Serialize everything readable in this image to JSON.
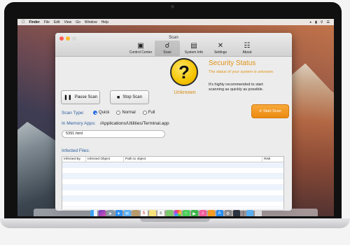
{
  "menubar": {
    "app_name": "Finder",
    "menus": [
      "File",
      "Edit",
      "View",
      "Go",
      "Window",
      "Help"
    ]
  },
  "window": {
    "title": "Scan",
    "toolbar": [
      {
        "label": "Control Center",
        "icon": "monitor-icon"
      },
      {
        "label": "Scan",
        "icon": "magnifier-icon",
        "active": true
      },
      {
        "label": "System Info",
        "icon": "info-card-icon"
      },
      {
        "label": "Settings",
        "icon": "wrench-screwdriver-icon"
      },
      {
        "label": "About",
        "icon": "document-icon"
      }
    ]
  },
  "controls": {
    "pause_label": "Pause Scan",
    "stop_label": "Stop Scan",
    "scan_type_label": "Scan Type:",
    "scan_types": [
      {
        "label": "Quick",
        "selected": true
      },
      {
        "label": "Normal",
        "selected": false
      },
      {
        "label": "Full",
        "selected": false
      }
    ],
    "memory_label": "In Memory Apps:",
    "memory_path": "/Applications/Utilities/Terminal.app",
    "current_file": "5391.html"
  },
  "status": {
    "symbol": "?",
    "state": "Unknown",
    "title": "Security Status",
    "subtitle": "The status of your system is unknown.",
    "note": "It's highly recommended to start scanning as quickly as possible.",
    "start_label": "Start Scan",
    "accent": "#e19216"
  },
  "infected": {
    "label": "Infected Files:",
    "columns": [
      "Infected By",
      "Infected Object",
      "Path to object",
      "Risk"
    ],
    "rows": []
  },
  "dock": {
    "icons": [
      "finder-icon",
      "siri-icon",
      "launchpad-icon",
      "safari-icon",
      "mail-icon",
      "contacts-icon",
      "calendar-icon",
      "notes-icon",
      "reminders-icon",
      "maps-icon",
      "photos-icon",
      "messages-icon",
      "facetime-icon",
      "itunes-icon",
      "ibooks-icon",
      "app-store-icon",
      "system-preferences-icon",
      "scanner-app-icon",
      "downloads-folder-icon",
      "trash-icon"
    ]
  }
}
